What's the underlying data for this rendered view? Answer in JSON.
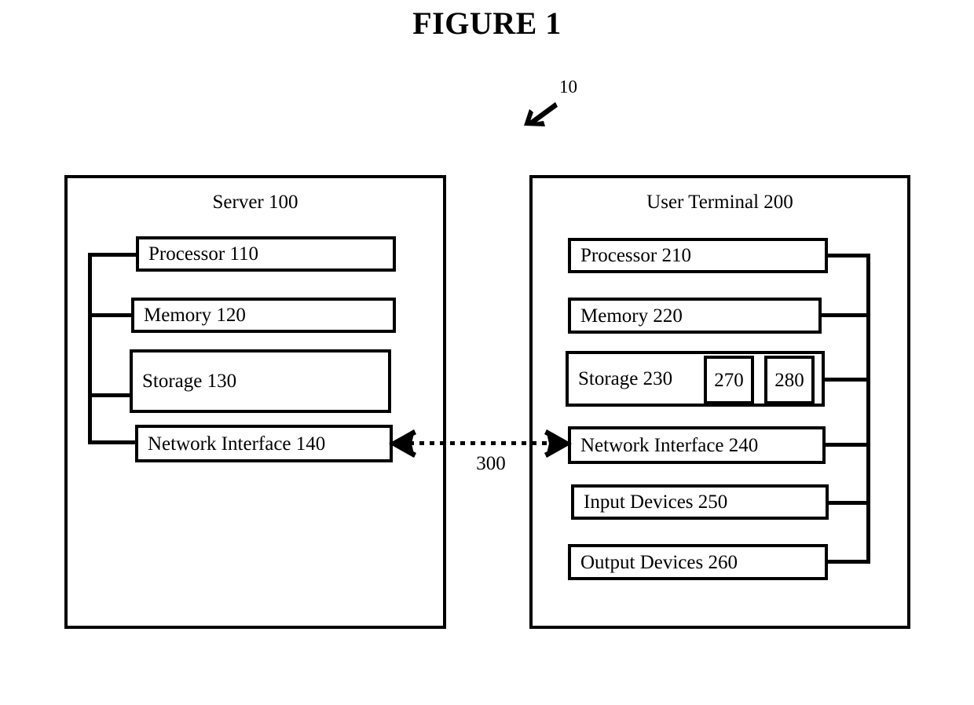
{
  "figure": {
    "title": "FIGURE 1",
    "system_reference": "10"
  },
  "server": {
    "title": "Server 100",
    "components": [
      {
        "label": "Processor 110"
      },
      {
        "label": "Memory 120"
      },
      {
        "label": "Storage 130"
      },
      {
        "label": "Network Interface 140"
      }
    ]
  },
  "terminal": {
    "title": "User Terminal 200",
    "components": [
      {
        "label": "Processor 210"
      },
      {
        "label": "Memory 220"
      },
      {
        "label": "Storage 230"
      },
      {
        "label": "Network Interface 240"
      },
      {
        "label": "Input Devices 250"
      },
      {
        "label": "Output Devices 260"
      }
    ],
    "storage_sub_modules": [
      {
        "label": "270"
      },
      {
        "label": "280"
      }
    ]
  },
  "network_link": {
    "label": "300",
    "style": "dotted-bidirectional-arrow"
  },
  "icons": {
    "system_pointer": "arrow-down-left-icon",
    "link_left": "arrow-left-icon",
    "link_right": "arrow-right-icon"
  },
  "colors": {
    "ink": "#000000",
    "paper": "#ffffff"
  }
}
